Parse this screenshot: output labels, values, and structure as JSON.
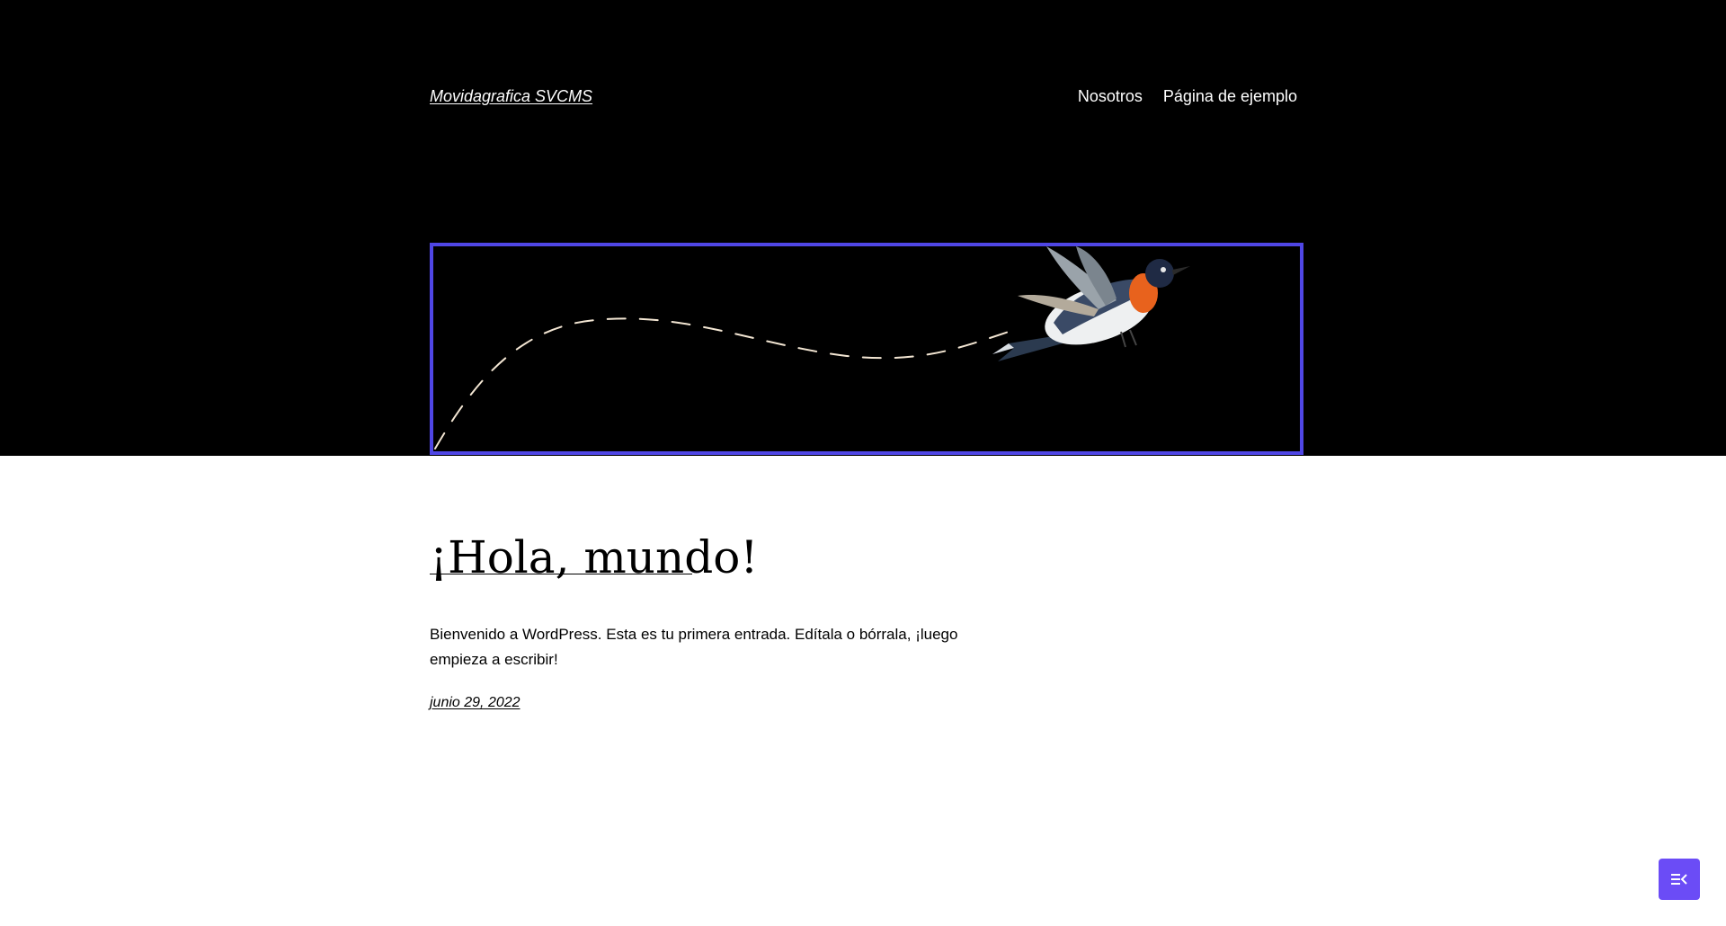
{
  "header": {
    "site_title": "Movidagrafica SVCMS",
    "nav": {
      "items": [
        {
          "label": "Nosotros"
        },
        {
          "label": "Página de ejemplo"
        }
      ]
    },
    "media": {
      "description_icons": [
        "dashed-flight-path",
        "bird-illustration"
      ],
      "border_color": "#4f46e5"
    }
  },
  "post": {
    "title": "¡Hola, mundo!",
    "excerpt": "Bienvenido a WordPress. Esta es tu primera entrada. Edítala o bórrala, ¡luego empieza a escribir!",
    "date": "junio 29, 2022"
  },
  "floating_button": {
    "icon": "collapse-menu-icon",
    "color": "#6b4cf6"
  },
  "colors": {
    "header_background": "#000000",
    "page_background": "#ffffff",
    "accent": "#4f46e5"
  }
}
